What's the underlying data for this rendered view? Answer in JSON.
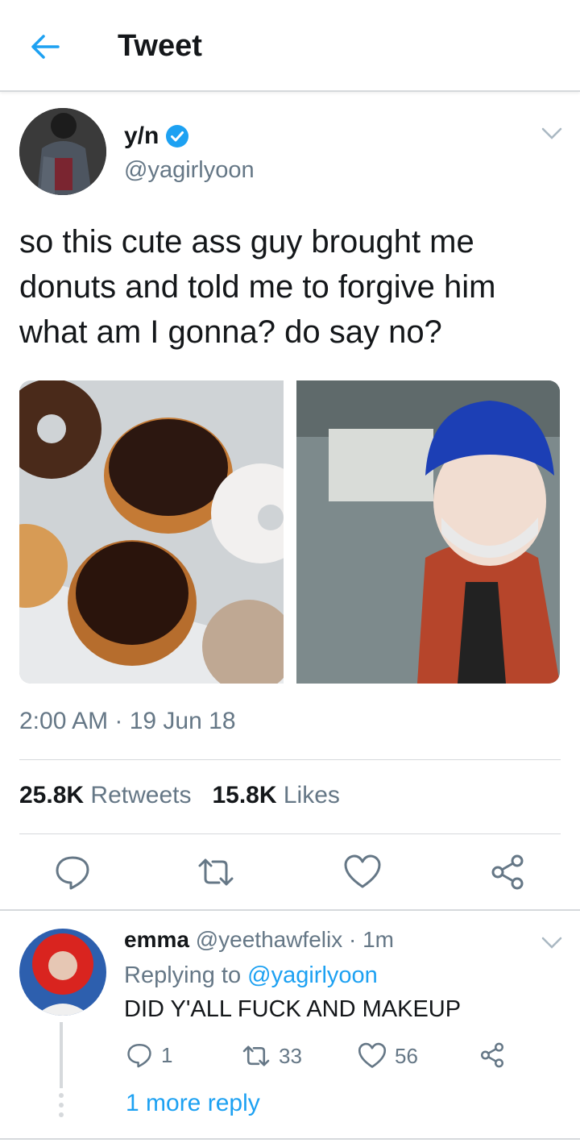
{
  "header": {
    "title": "Tweet"
  },
  "tweet": {
    "name": "y/n",
    "handle": "@yagirlyoon",
    "text": "so this cute ass guy brought me donuts and told me to forgive him what am I gonna? do say no?",
    "timestamp": "2:00 AM · 19 Jun 18",
    "retweets_count": "25.8K",
    "retweets_label": "Retweets",
    "likes_count": "15.8K",
    "likes_label": "Likes"
  },
  "reply": {
    "name": "emma",
    "handle_time": "@yeethawfelix · 1m",
    "replying_prefix": "Replying to",
    "replying_handle": "@yagirlyoon",
    "text": "DID Y'ALL FUCK AND MAKEUP",
    "replies": "1",
    "retweets": "33",
    "likes": "56",
    "more_replies": "1 more reply"
  },
  "colors": {
    "accent": "#1da1f2",
    "muted": "#657786",
    "text": "#14171a",
    "divider": "#d6d9dc"
  }
}
